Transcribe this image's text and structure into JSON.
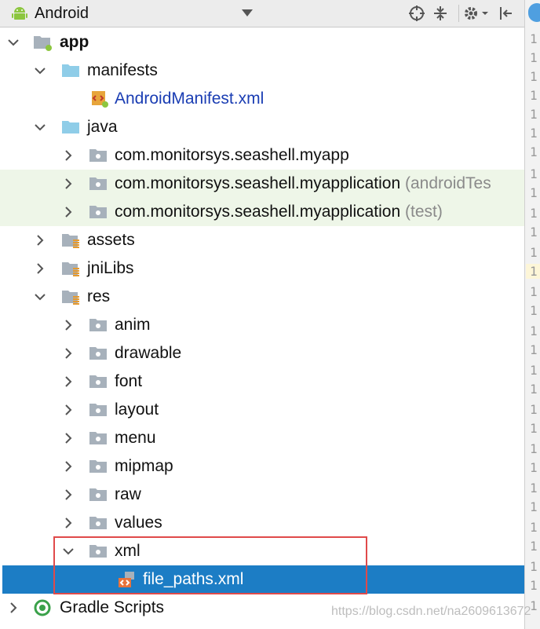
{
  "toolbar": {
    "title": "Android"
  },
  "tree": {
    "rows": [
      {
        "label": "app"
      },
      {
        "label": "manifests"
      },
      {
        "label": "AndroidManifest.xml"
      },
      {
        "label": "java"
      },
      {
        "label": "com.monitorsys.seashell.myapp"
      },
      {
        "label": "com.monitorsys.seashell.myapplication",
        "suffix": "(androidTes"
      },
      {
        "label": "com.monitorsys.seashell.myapplication",
        "suffix": "(test)"
      },
      {
        "label": "assets"
      },
      {
        "label": "jniLibs"
      },
      {
        "label": "res"
      },
      {
        "label": "anim"
      },
      {
        "label": "drawable"
      },
      {
        "label": "font"
      },
      {
        "label": "layout"
      },
      {
        "label": "menu"
      },
      {
        "label": "mipmap"
      },
      {
        "label": "raw"
      },
      {
        "label": "values"
      },
      {
        "label": "xml"
      },
      {
        "label": "file_paths.xml"
      },
      {
        "label": "Gradle Scripts"
      }
    ]
  },
  "gutter": {
    "line_digits": "1"
  },
  "watermark": "https://blog.csdn.net/na2609613672",
  "colors": {
    "selection": "#1c7dc5",
    "highlight_box": "#e04a4a",
    "tint": "#eef6e8",
    "link": "#1a3db3"
  }
}
